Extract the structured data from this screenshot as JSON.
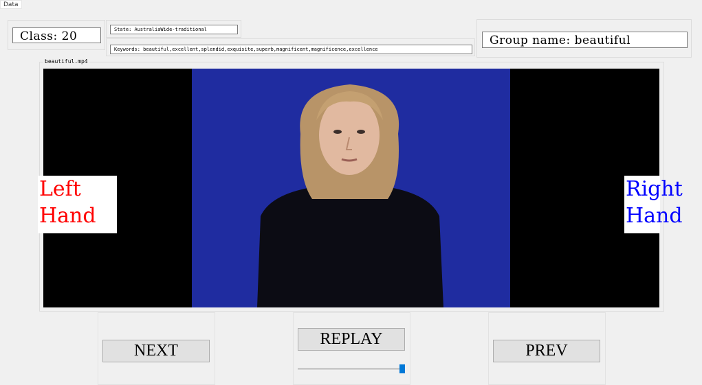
{
  "window": {
    "title": "Data"
  },
  "info": {
    "class_label": "Class: 20",
    "state_label": "State: AustraliaWide-traditional",
    "keywords_label": "Keywords: beautiful,excellent,splendid,exquisite,superb,magnificent,magnificence,excellence",
    "group_label": "Group name: beautiful"
  },
  "video": {
    "filename": "beautiful.mp4",
    "left_hand_label": "Left\nHand",
    "right_hand_label": "Right\nHand",
    "left_hand_color": "#ff0000",
    "right_hand_color": "#0000ff",
    "background_color": "#1f2ca0"
  },
  "controls": {
    "next_label": "NEXT",
    "replay_label": "REPLAY",
    "prev_label": "PREV",
    "progress_fraction": 1.0,
    "accent_color": "#0078d7"
  }
}
